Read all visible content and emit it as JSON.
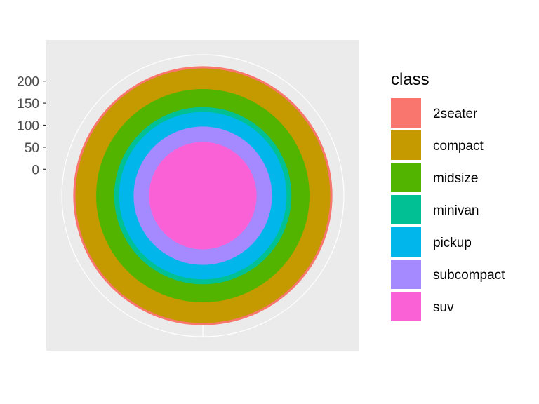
{
  "chart_data": {
    "type": "pie",
    "coord": "polar",
    "description_of_values": "stacked counts by class; outer cumulative total 234",
    "series": [
      {
        "name": "2seater",
        "value": 5,
        "color": "#F8766D"
      },
      {
        "name": "compact",
        "value": 47,
        "color": "#C49A00"
      },
      {
        "name": "midsize",
        "value": 41,
        "color": "#53B400"
      },
      {
        "name": "minivan",
        "value": 11,
        "color": "#00C094"
      },
      {
        "name": "pickup",
        "value": 33,
        "color": "#00B6EB"
      },
      {
        "name": "subcompact",
        "value": 35,
        "color": "#A58AFF"
      },
      {
        "name": "suv",
        "value": 62,
        "color": "#FB61D7"
      }
    ],
    "y_ticks": [
      0,
      50,
      100,
      150,
      200
    ],
    "ylim": [
      -60,
      260
    ],
    "legend": {
      "title": "class",
      "position": "right"
    },
    "panel_background": "#EBEBEB",
    "grid_color": "#FFFFFF"
  }
}
